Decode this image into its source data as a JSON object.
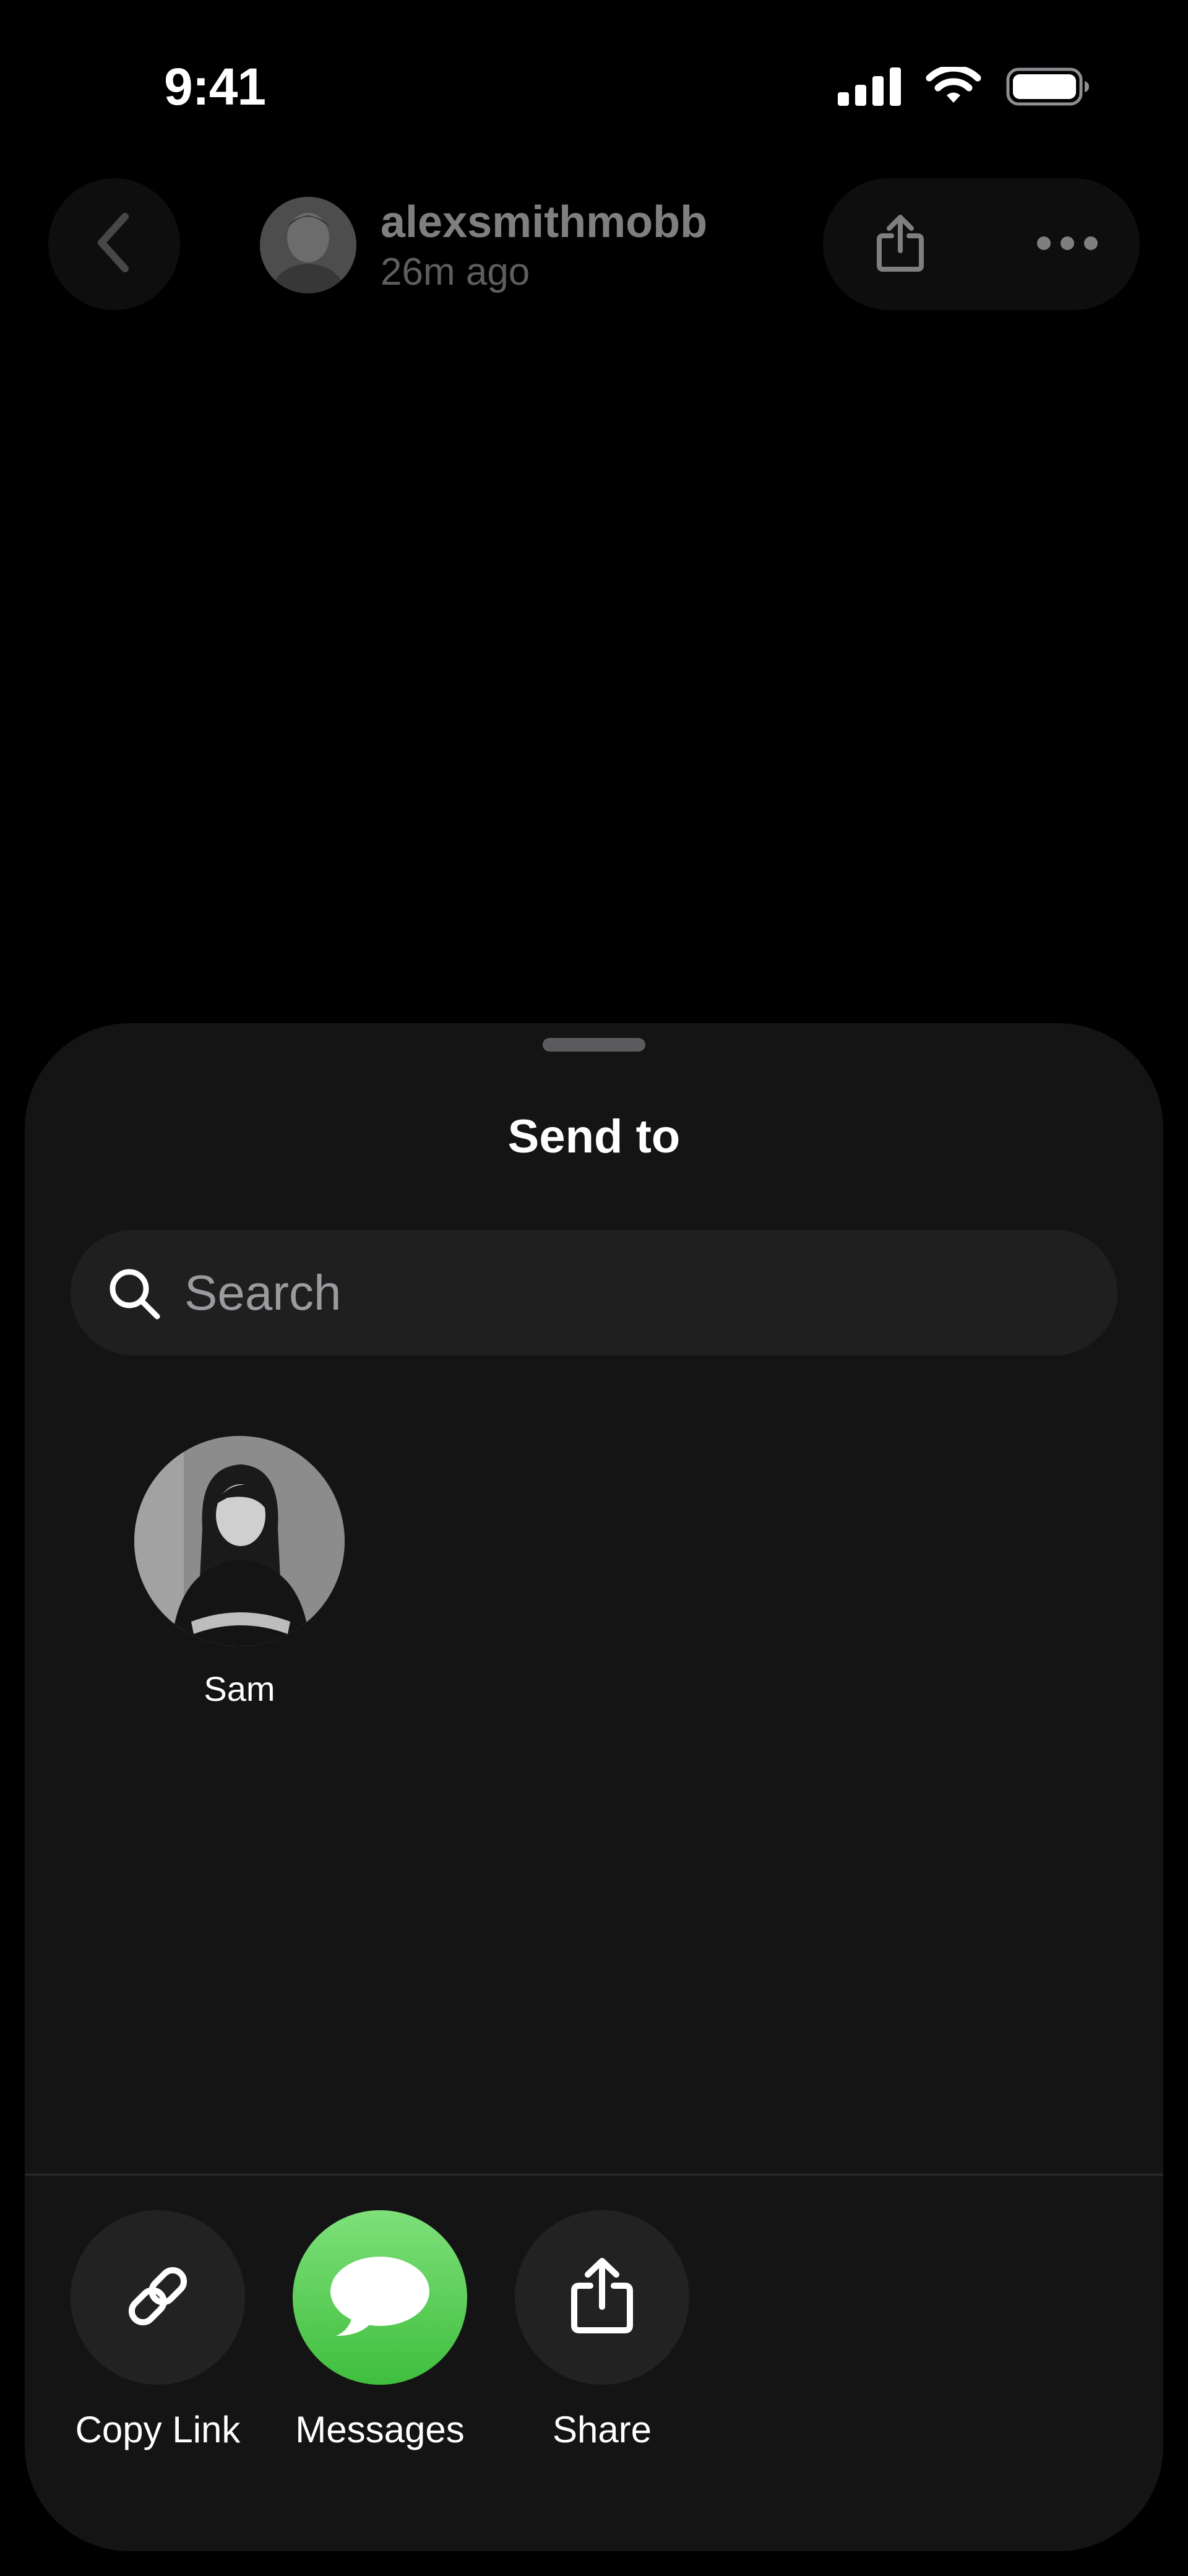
{
  "status_bar": {
    "time": "9:41",
    "icons": [
      "cellular-signal-icon",
      "wifi-icon",
      "battery-icon"
    ]
  },
  "header": {
    "back_icon": "chevron-left-icon",
    "username": "alexsmithmobb",
    "posted_time": "26m ago",
    "share_icon": "share-icon",
    "more_icon": "ellipsis-icon"
  },
  "sheet": {
    "title": "Send to",
    "search": {
      "placeholder": "Search",
      "value": ""
    },
    "contacts": [
      {
        "name": "Sam"
      }
    ],
    "share_options": [
      {
        "label": "Copy Link",
        "icon": "link-icon"
      },
      {
        "label": "Messages",
        "icon": "messages-icon"
      },
      {
        "label": "Share",
        "icon": "share-icon"
      }
    ]
  },
  "colors": {
    "background": "#000000",
    "sheet": "#141414",
    "search_field": "#1f1f1f",
    "button_circle": "#222222",
    "messages_green": "#4cd04a"
  }
}
